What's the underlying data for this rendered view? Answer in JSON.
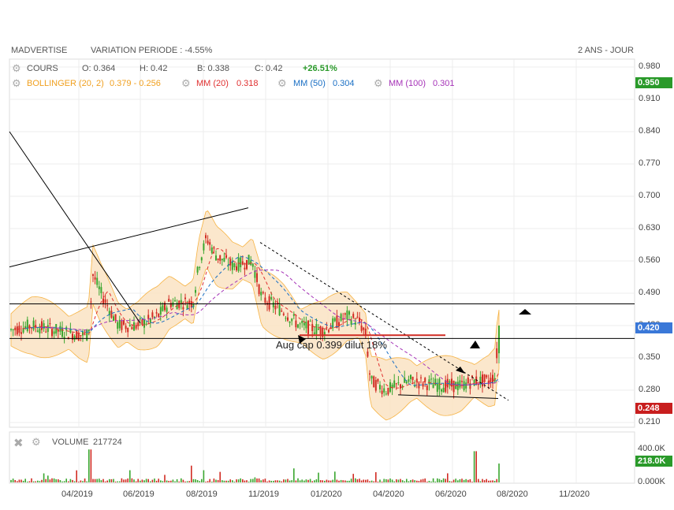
{
  "header": {
    "symbol": "MADVERTISE",
    "variation": "VARIATION PERIODE : -4.55%",
    "period": "2 ANS - JOUR"
  },
  "legend": {
    "cours_label": "COURS",
    "open": "O: 0.364",
    "high": "H: 0.42",
    "low": "B: 0.338",
    "close": "C: 0.42",
    "change": "+26.51%",
    "bollinger": "BOLLINGER (20, 2)",
    "bollinger_values": "0.379 - 0.256",
    "mm20": "MM (20)",
    "mm20_value": "0.318",
    "mm50": "MM (50)",
    "mm50_value": "0.304",
    "mm100": "MM (100)",
    "mm100_value": "0.301"
  },
  "volume": {
    "label": "VOLUME",
    "value": "217724"
  },
  "badges": {
    "top": "0.950",
    "last": "0.420",
    "low": "0.248",
    "volume": "218.0K"
  },
  "annotation": "Aug cap 0.399 dilut 18%",
  "colors": {
    "up": "#3aa62f",
    "down": "#d12c23",
    "bollinger": "#f5a623",
    "mm20": "#e03030",
    "mm50": "#1a6fc4",
    "mm100": "#a633b8",
    "green_badge": "#2a9a2a",
    "blue_badge": "#3a78d8",
    "red_badge": "#c81e1e"
  },
  "chart_data": {
    "type": "candlestick",
    "y_ticks": [
      "0.980",
      "0.910",
      "0.840",
      "0.770",
      "0.700",
      "0.630",
      "0.560",
      "0.490",
      "0.420",
      "0.350",
      "0.280",
      "0.210"
    ],
    "x_ticks": [
      "04/2019",
      "06/2019",
      "08/2019",
      "11/2019",
      "01/2020",
      "04/2020",
      "06/2020",
      "08/2020",
      "11/2020"
    ],
    "ylim": [
      0.2,
      0.99
    ],
    "volume_ticks": [
      "400.0K",
      "0.000K"
    ],
    "horizontal_lines": [
      0.467,
      0.392
    ],
    "last_close": 0.42,
    "price_path": [
      [
        "03/2019",
        0.41
      ],
      [
        "03/2019",
        0.42
      ],
      [
        "04/2019",
        0.4
      ],
      [
        "04/2019",
        0.52
      ],
      [
        "04/2019",
        0.5
      ],
      [
        "05/2019",
        0.43
      ],
      [
        "05/2019",
        0.41
      ],
      [
        "06/2019",
        0.42
      ],
      [
        "06/2019",
        0.43
      ],
      [
        "07/2019",
        0.47
      ],
      [
        "07/2019",
        0.48
      ],
      [
        "08/2019",
        0.46
      ],
      [
        "08/2019",
        0.61
      ],
      [
        "08/2019",
        0.59
      ],
      [
        "09/2019",
        0.56
      ],
      [
        "10/2019",
        0.55
      ],
      [
        "10/2019",
        0.57
      ],
      [
        "11/2019",
        0.48
      ],
      [
        "11/2019",
        0.45
      ],
      [
        "12/2019",
        0.42
      ],
      [
        "12/2019",
        0.41
      ],
      [
        "01/2020",
        0.44
      ],
      [
        "01/2020",
        0.43
      ],
      [
        "02/2020",
        0.46
      ],
      [
        "02/2020",
        0.42
      ],
      [
        "03/2020",
        0.3
      ],
      [
        "03/2020",
        0.28
      ],
      [
        "04/2020",
        0.27
      ],
      [
        "04/2020",
        0.31
      ],
      [
        "05/2020",
        0.3
      ],
      [
        "05/2020",
        0.29
      ],
      [
        "06/2020",
        0.28
      ],
      [
        "06/2020",
        0.31
      ],
      [
        "07/2020",
        0.3
      ],
      [
        "07/2020",
        0.3
      ],
      [
        "08/2020",
        0.42
      ]
    ]
  }
}
